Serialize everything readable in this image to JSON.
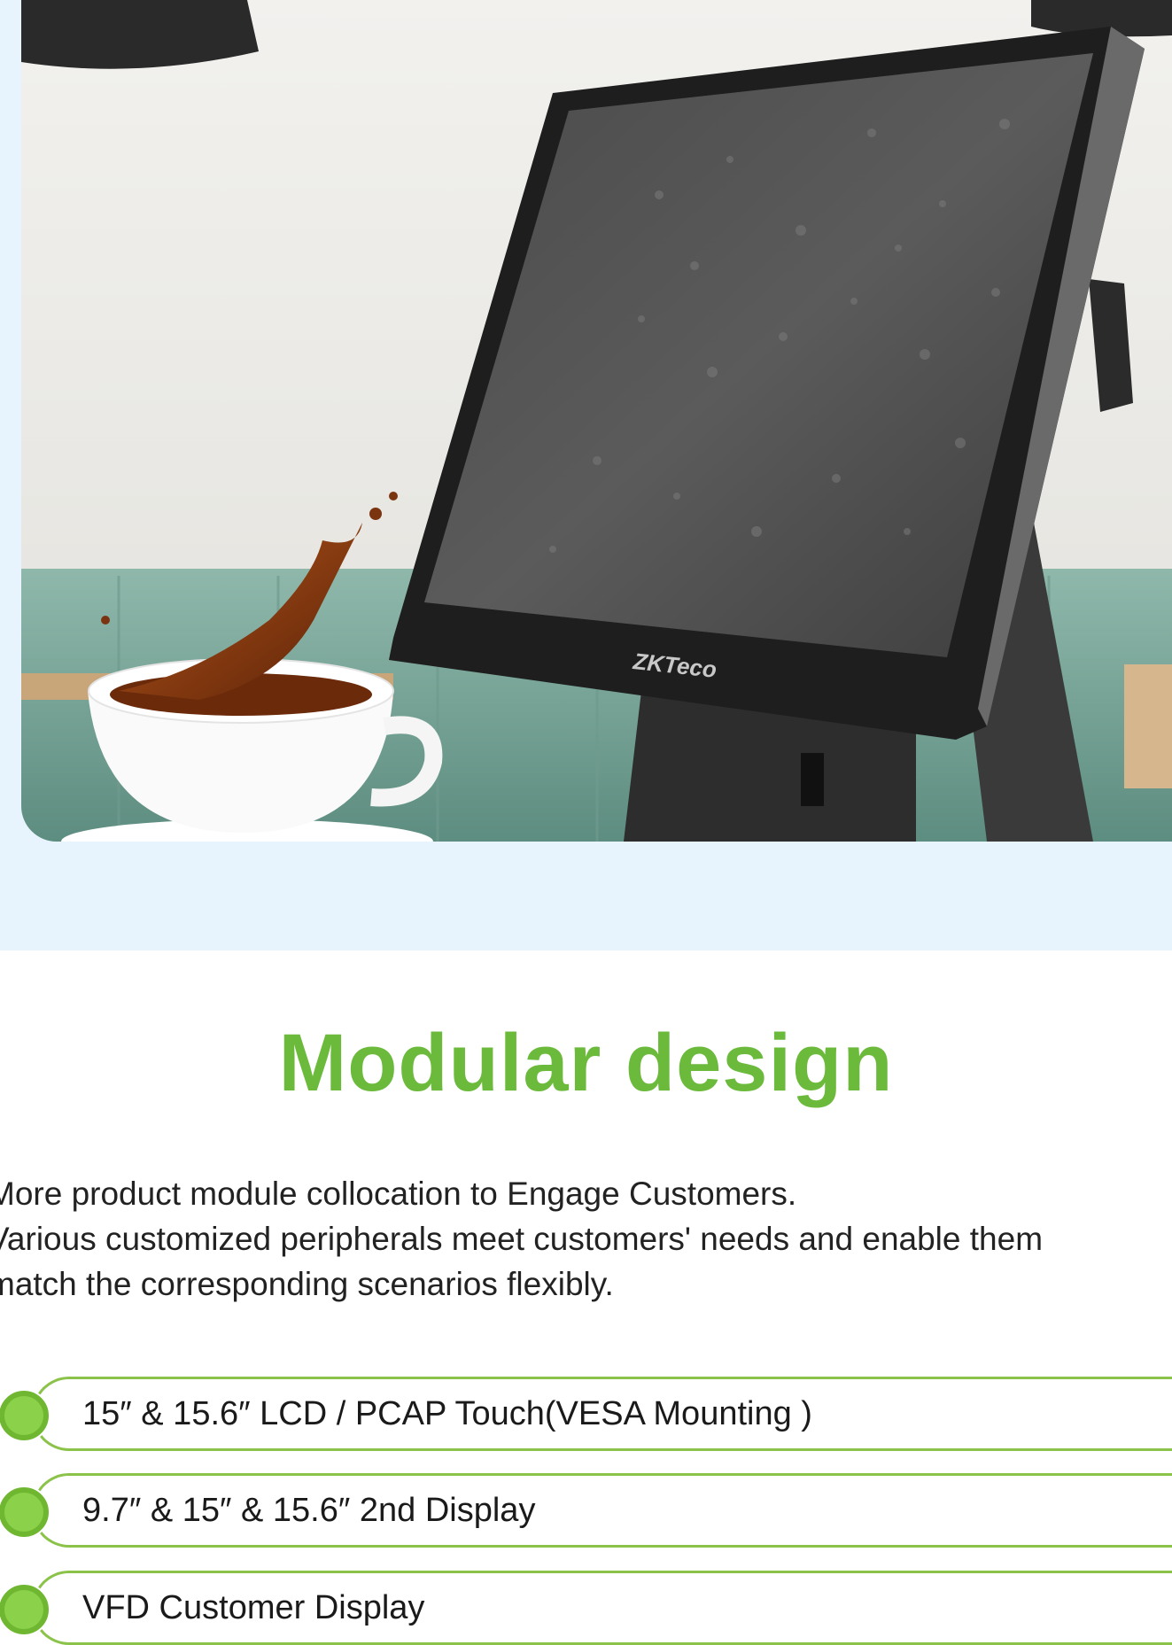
{
  "brand": {
    "logo_text": "ZKTeco",
    "accent": "#6cba3c"
  },
  "section": {
    "title": "Modular design",
    "intro_lines": [
      "More product module collocation to Engage Customers.",
      "Various customized peripherals meet customers' needs and enable them",
      "match the corresponding scenarios flexibly."
    ]
  },
  "features": [
    {
      "label": "15″ & 15.6″ LCD / PCAP Touch(VESA Mounting )"
    },
    {
      "label": "9.7″ & 15″ & 15.6″ 2nd Display"
    },
    {
      "label": "VFD Customer Display"
    }
  ]
}
